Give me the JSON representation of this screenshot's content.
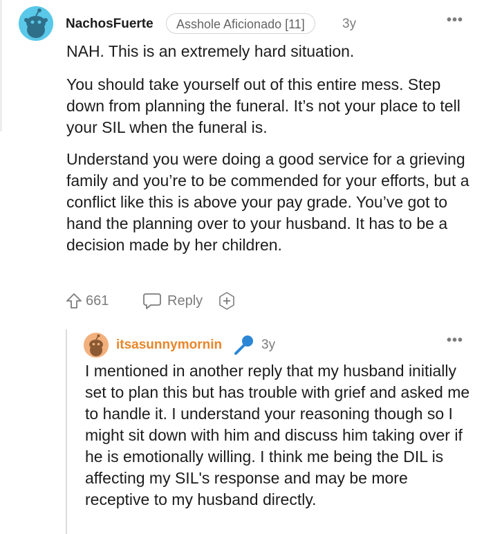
{
  "comment": {
    "username": "NachosFuerte",
    "flair": "Asshole Aficionado [11]",
    "age": "3y",
    "more_label": "•••",
    "paragraphs": [
      "NAH. This is an extremely hard situation.",
      "You should take yourself out of this entire mess. Step down from planning the funeral. It’s not your place to tell your SIL when the funeral is.",
      "Understand you were doing a good service for a grieving family and you’re to be commended for your efforts, but a conflict like this is above your pay grade. You’ve got to hand the planning over to your husband. It has to be a decision made by her children."
    ],
    "upvotes": "661",
    "reply_label": "Reply",
    "avatar_color": "#5ac8e8"
  },
  "reply": {
    "username": "itsasunnymornin",
    "age": "3y",
    "more_label": "•••",
    "body": "I mentioned in another reply that my husband initially set to plan this but has trouble with grief and asked me to handle it. I understand your reasoning though so I might sit down with him and discuss him taking over if he is emotionally willing. I think me being the DIL is affecting my SIL's response and may be more receptive to my husband directly.",
    "username_color": "#e8862a",
    "avatar_color": "#f2b07c",
    "badge_icon": "microphone-icon"
  }
}
